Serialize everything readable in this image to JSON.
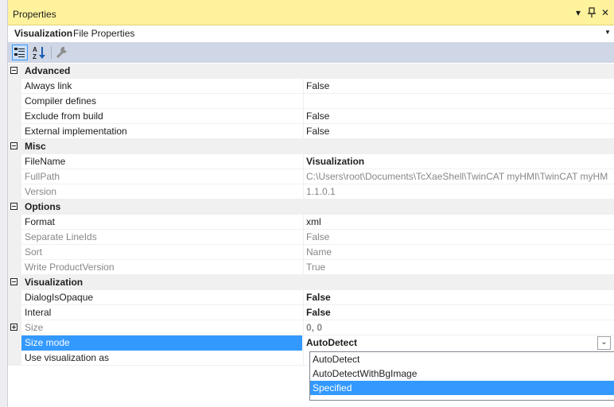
{
  "window": {
    "title": "Properties",
    "buttons": [
      "▾",
      "⊥",
      "✕"
    ]
  },
  "object": {
    "name": "Visualization",
    "type": "File Properties"
  },
  "toolbar": {
    "tools": [
      "categorized-icon",
      "alphabetical-icon",
      "property-pages-icon"
    ]
  },
  "categories": [
    {
      "label": "Advanced",
      "expanded": true,
      "props": [
        {
          "name": "Always link",
          "value": "False",
          "readonly": false,
          "bold": false
        },
        {
          "name": "Compiler defines",
          "value": "",
          "readonly": false,
          "bold": false
        },
        {
          "name": "Exclude from build",
          "value": "False",
          "readonly": false,
          "bold": false
        },
        {
          "name": "External implementation",
          "value": "False",
          "readonly": false,
          "bold": false
        }
      ]
    },
    {
      "label": "Misc",
      "expanded": true,
      "props": [
        {
          "name": "FileName",
          "value": "Visualization",
          "readonly": false,
          "bold": true
        },
        {
          "name": "FullPath",
          "value": "C:\\Users\\root\\Documents\\TcXaeShell\\TwinCAT myHMI\\TwinCAT myHM",
          "readonly": true,
          "bold": false
        },
        {
          "name": "Version",
          "value": "1.1.0.1",
          "readonly": true,
          "bold": false
        }
      ]
    },
    {
      "label": "Options",
      "expanded": true,
      "props": [
        {
          "name": "Format",
          "value": "xml",
          "readonly": false,
          "bold": false
        },
        {
          "name": "Separate LineIds",
          "value": "False",
          "readonly": true,
          "bold": false
        },
        {
          "name": "Sort",
          "value": "Name",
          "readonly": true,
          "bold": false
        },
        {
          "name": "Write ProductVersion",
          "value": "True",
          "readonly": true,
          "bold": false
        }
      ]
    },
    {
      "label": "Visualization",
      "expanded": true,
      "props": [
        {
          "name": "DialogIsOpaque",
          "value": "False",
          "readonly": false,
          "bold": true
        },
        {
          "name": "Interal",
          "value": "False",
          "readonly": false,
          "bold": true
        },
        {
          "name": "Size",
          "value": "0, 0",
          "readonly": true,
          "bold": true,
          "collapsed": true
        },
        {
          "name": "Size mode",
          "value": "AutoDetect",
          "readonly": false,
          "bold": true,
          "selected": true
        },
        {
          "name": "Use visualization as",
          "value": "",
          "readonly": false,
          "bold": false
        }
      ]
    }
  ],
  "dropdown": {
    "options": [
      "AutoDetect",
      "AutoDetectWithBgImage",
      "Specified"
    ],
    "highlighted": "Specified"
  },
  "colors": {
    "title_bg": "#fff29d",
    "selection": "#3399ff",
    "toolbar_bg": "#cfd6e5",
    "category_bg": "#f0f0f0"
  }
}
